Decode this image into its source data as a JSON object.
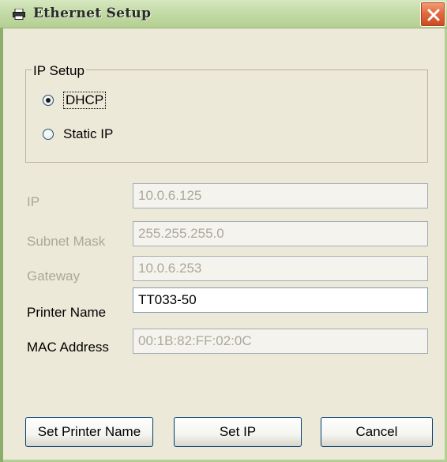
{
  "window": {
    "title": "Ethernet Setup",
    "title_icon": "printer-icon",
    "close_icon": "close-icon",
    "close_color": "#e36b3f"
  },
  "ip_setup": {
    "legend": "IP Setup",
    "options": [
      {
        "label": "DHCP",
        "selected": true
      },
      {
        "label": "Static IP",
        "selected": false
      }
    ]
  },
  "fields": {
    "ip": {
      "label": "IP",
      "value": "10.0.6.125",
      "enabled": false
    },
    "subnet_mask": {
      "label": "Subnet Mask",
      "value": "255.255.255.0",
      "enabled": false
    },
    "gateway": {
      "label": "Gateway",
      "value": "10.0.6.253",
      "enabled": false
    },
    "printer_name": {
      "label": "Printer Name",
      "value": "TT033-50",
      "enabled": true
    },
    "mac_address": {
      "label": "MAC Address",
      "value": "00:1B:82:FF:02:0C",
      "enabled": false
    }
  },
  "buttons": {
    "set_printer_name": "Set Printer Name",
    "set_ip": "Set IP",
    "cancel": "Cancel"
  }
}
